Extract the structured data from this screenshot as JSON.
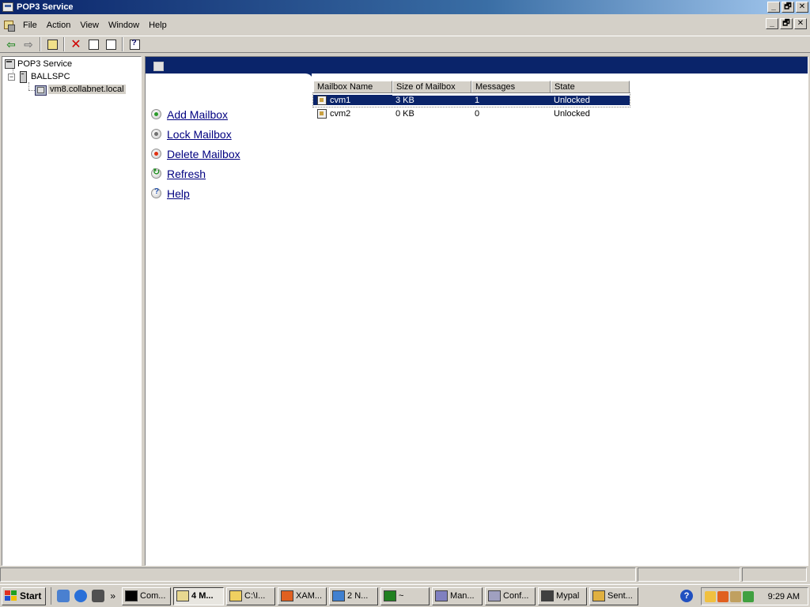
{
  "window": {
    "title": "POP3 Service",
    "minimize": "_",
    "maximize": "🗗",
    "close": "✕"
  },
  "menubar": {
    "items": [
      {
        "label": "File"
      },
      {
        "label": "Action"
      },
      {
        "label": "View"
      },
      {
        "label": "Window"
      },
      {
        "label": "Help"
      }
    ]
  },
  "toolbar": {
    "back": "⇦",
    "forward": "⇨",
    "delete": "✕"
  },
  "tree": {
    "root": "POP3 Service",
    "server": "BALLSPC",
    "domain": "vm8.collabnet.local",
    "expand_sign": "−"
  },
  "tasks": [
    {
      "label": "Add Mailbox",
      "icon": "add-icon"
    },
    {
      "label": "Lock Mailbox",
      "icon": "lock-icon"
    },
    {
      "label": "Delete Mailbox",
      "icon": "delete-icon"
    },
    {
      "label": "Refresh",
      "icon": "refresh-icon"
    },
    {
      "label": "Help",
      "icon": "help-icon"
    }
  ],
  "listview": {
    "columns": [
      "Mailbox Name",
      "Size of Mailbox",
      "Messages",
      "State"
    ],
    "rows": [
      {
        "name": "cvm1",
        "size": "3 KB",
        "messages": "1",
        "state": "Unlocked",
        "selected": true
      },
      {
        "name": "cvm2",
        "size": "0 KB",
        "messages": "0",
        "state": "Unlocked",
        "selected": false
      }
    ]
  },
  "taskbar": {
    "start": "Start",
    "quicklaunch_more": "»",
    "buttons": [
      {
        "label": "Com...",
        "color": "#000000"
      },
      {
        "label": "4 M...",
        "color": "#e8d890",
        "active": true
      },
      {
        "label": "C:\\I...",
        "color": "#f0d060"
      },
      {
        "label": "XAM...",
        "color": "#e06020"
      },
      {
        "label": "2 N...",
        "color": "#4080d0"
      },
      {
        "label": "~",
        "color": "#208020"
      },
      {
        "label": "Man...",
        "color": "#8080c0"
      },
      {
        "label": "Conf...",
        "color": "#a0a0c0"
      },
      {
        "label": "Mypal",
        "color": "#404040"
      },
      {
        "label": "Sent...",
        "color": "#e0b040"
      }
    ],
    "clock": "9:29 AM"
  }
}
